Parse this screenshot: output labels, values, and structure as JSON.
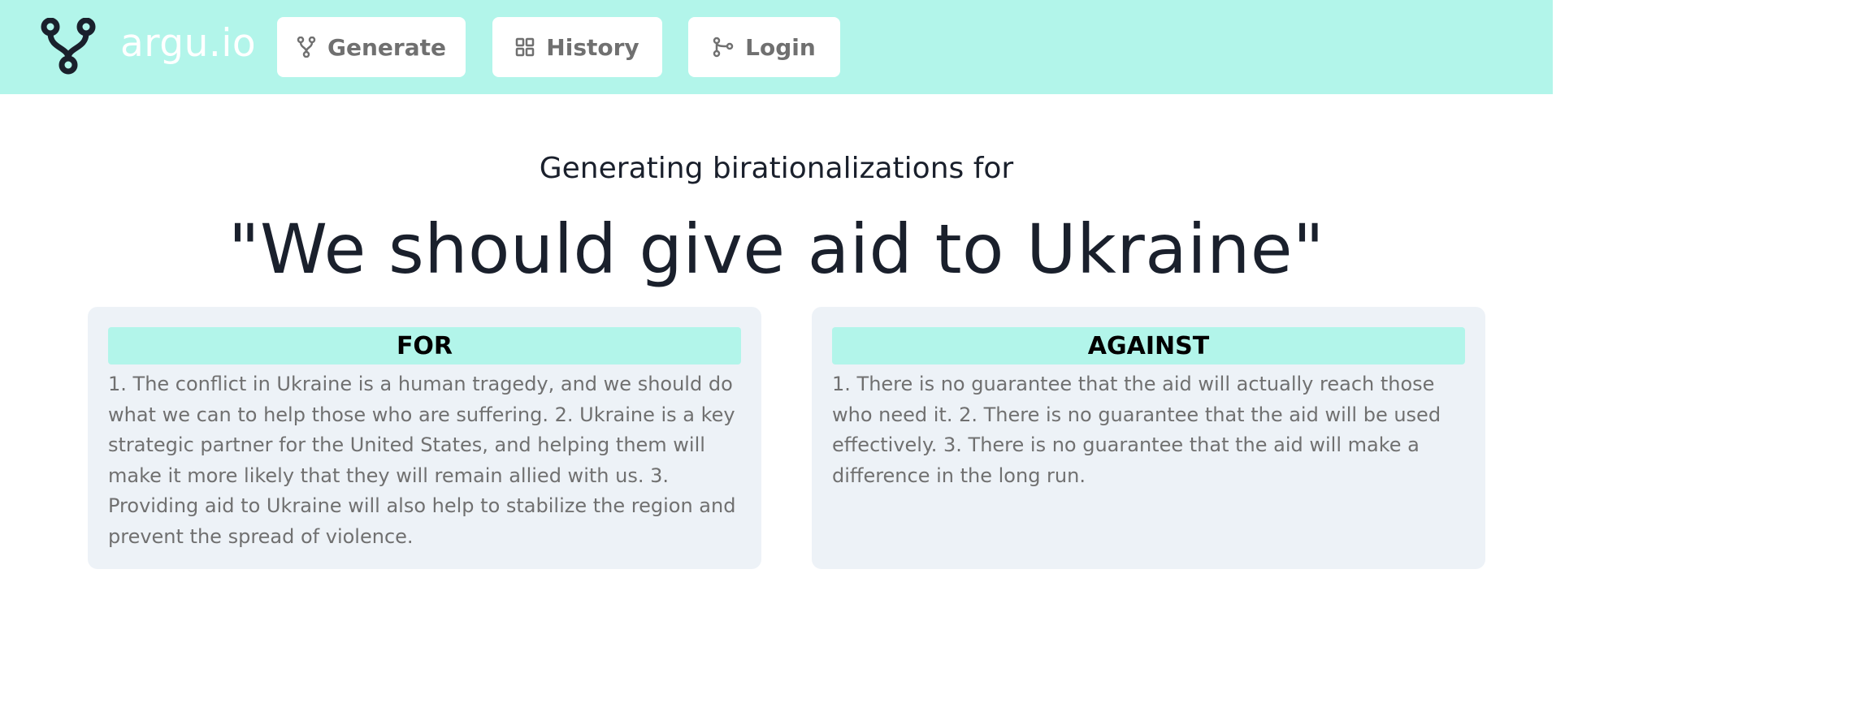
{
  "navbar": {
    "logo_icon": "branch-fork-icon",
    "brand": "argu.io",
    "buttons": [
      {
        "icon": "branch-fork-icon",
        "label": "Generate"
      },
      {
        "icon": "grid-icon",
        "label": "History"
      },
      {
        "icon": "git-branch-icon",
        "label": "Login"
      }
    ]
  },
  "main": {
    "subtitle": "Generating birationalizations for",
    "title": "\"We should give aid to Ukraine\""
  },
  "columns": {
    "for": {
      "header": "FOR",
      "text": "1. The conflict in Ukraine is a human tragedy, and we should do what we can to help those who are suffering. 2. Ukraine is a key strategic partner for the United States, and helping them will make it more likely that they will remain allied with us. 3. Providing aid to Ukraine will also help to stabilize the region and prevent the spread of violence."
    },
    "against": {
      "header": "AGAINST",
      "text": "1. There is no guarantee that the aid will actually reach those who need it. 2. There is no guarantee that the aid will be used effectively. 3. There is no guarantee that the aid will make a difference in the long run."
    }
  },
  "colors": {
    "accent": "#b2f5ea",
    "card_bg": "#edf2f7",
    "title_text": "#1a202c",
    "body_text": "#707070"
  }
}
